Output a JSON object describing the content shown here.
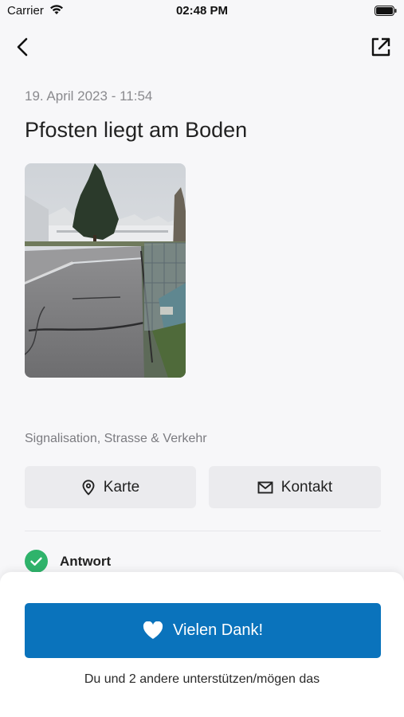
{
  "status_bar": {
    "carrier": "Carrier",
    "time": "02:48 PM"
  },
  "report": {
    "date": "19. April 2023 - 11:54",
    "title": "Pfosten liegt am Boden",
    "category": "Signalisation, Strasse & Verkehr"
  },
  "actions": {
    "map_label": "Karte",
    "contact_label": "Kontakt"
  },
  "answer": {
    "label": "Antwort"
  },
  "bottom_sheet": {
    "thanks_label": "Vielen Dank!",
    "support_text": "Du und 2 andere unterstützen/mögen das"
  },
  "colors": {
    "accent": "#0a73bc",
    "success": "#2fb36b"
  },
  "icons": {
    "back": "chevron-left-icon",
    "share": "external-link-icon",
    "map": "location-pin-icon",
    "contact": "envelope-icon",
    "answer": "check-circle-icon",
    "thanks": "heart-icon"
  }
}
